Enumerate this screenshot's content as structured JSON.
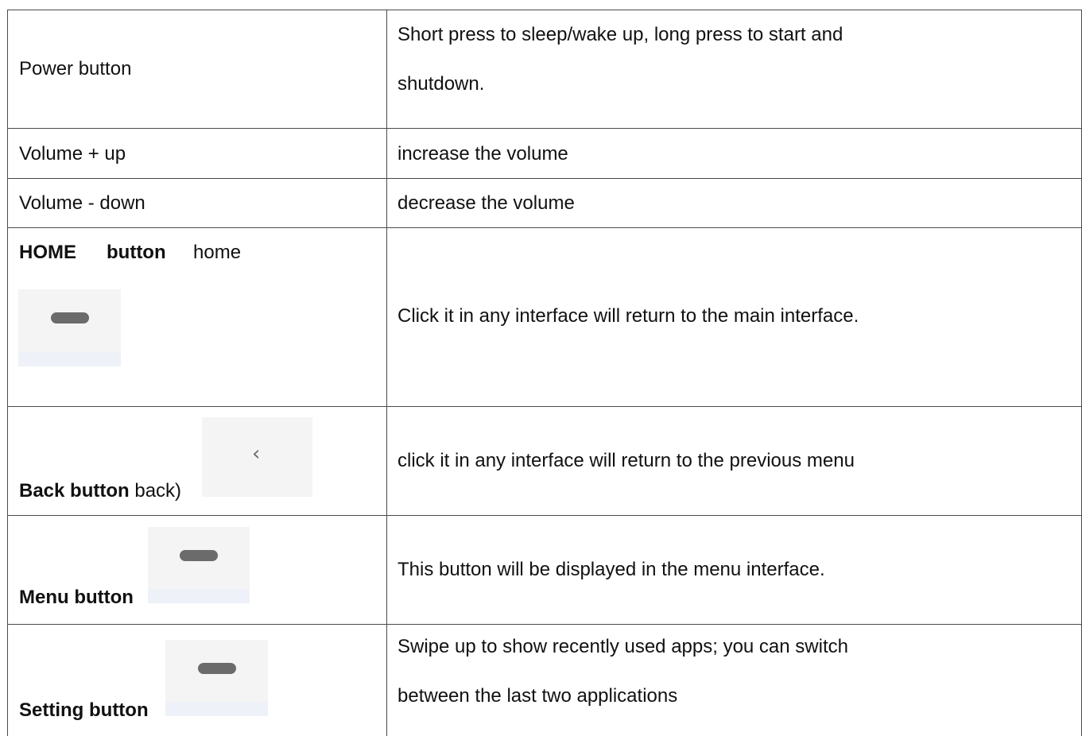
{
  "table": {
    "rows": [
      {
        "name": "Power button",
        "desc_lines": [
          "Short press to sleep/wake up, long press to start and",
          "shutdown."
        ]
      },
      {
        "name": "Volume + up",
        "desc_lines": [
          "increase the volume"
        ]
      },
      {
        "name": "Volume - down",
        "desc_lines": [
          "decrease the volume"
        ]
      },
      {
        "name_bold": "HOME",
        "name_bold2": "button",
        "name_extra": "home",
        "icon": "home-pill-icon",
        "desc_lines": [
          "Click it in any interface will return to the main interface."
        ]
      },
      {
        "name_bold": "Back button",
        "name_extra": "back)",
        "icon": "chevron-left-icon",
        "icon_glyph": "‹",
        "desc_lines": [
          "click it in any interface will return to the previous menu"
        ]
      },
      {
        "name_bold": "Menu button",
        "icon": "menu-pill-icon",
        "desc_lines": [
          "This button will be displayed in the menu interface."
        ]
      },
      {
        "name_bold": "Setting button",
        "icon": "setting-pill-icon",
        "desc_lines": [
          "Swipe up to show recently used apps; you can switch",
          "between the last two applications"
        ]
      }
    ]
  }
}
